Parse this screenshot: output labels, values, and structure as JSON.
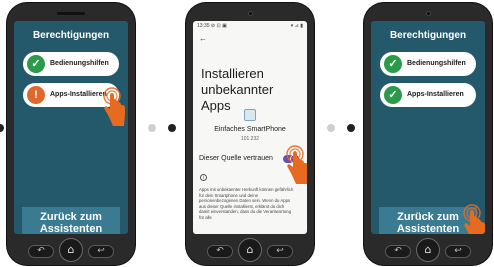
{
  "step1": {
    "title": "Berechtigungen",
    "items": [
      {
        "label": "Bedienungshilfen",
        "status": "check"
      },
      {
        "label": "Apps-Installieren",
        "status": "alert"
      }
    ],
    "back_button": "Zurück zum Assistenten"
  },
  "step2": {
    "status_time": "13:35",
    "status_icons_left": "⊘ ⊡ ▣",
    "status_icons_right": "▾ ⊿ ▮",
    "back_arrow": "←",
    "title": "Installieren unbekannter Apps",
    "app_name": "Einfaches SmartPhone",
    "app_version": "101.232",
    "trust_label": "Dieser Quelle vertrauen",
    "trust_enabled": true,
    "info_glyph": "i",
    "info_text": "Apps mit unbekannter Herkunft können gefährlich für dein Smartphone und deine personenbezogenen Daten sein. Wenn du Apps aus dieser Quelle installierst, erklärst du dich damit einverstanden, dass du die Verantwortung für alle"
  },
  "step3": {
    "title": "Berechtigungen",
    "items": [
      {
        "label": "Bedienungshilfen",
        "status": "check"
      },
      {
        "label": "Apps-Installieren",
        "status": "check"
      }
    ],
    "back_button": "Zurück zum Assistenten"
  },
  "nav": {
    "back_glyph": "↶",
    "home_glyph": "⌂",
    "recent_glyph": "↩"
  },
  "icons": {
    "check": "✓",
    "alert": "!",
    "hand": "pointing-hand-icon",
    "toggle": "toggle-switch-icon"
  },
  "colors": {
    "screen_blue": "#24586b",
    "button_blue": "#3a7b92",
    "check_green": "#2b9a49",
    "alert_orange": "#e0682a",
    "toggle_purple": "#6b4fb0",
    "hand_orange": "#e66a1f"
  }
}
